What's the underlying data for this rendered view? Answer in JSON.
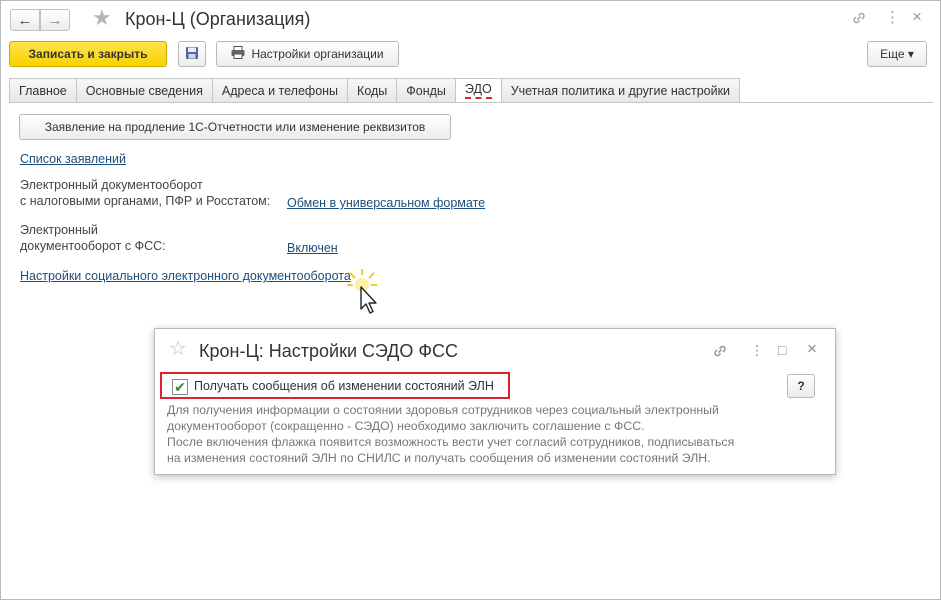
{
  "window": {
    "title": "Крон-Ц (Организация)",
    "nav_back": "←",
    "nav_forward": "→",
    "link_icon": "link-icon",
    "more_icon": "⋮",
    "close_icon": "×"
  },
  "toolbar": {
    "save_close_label": "Записать и закрыть",
    "save_icon": "floppy-disk-icon",
    "org_settings_label": "Настройки организации",
    "more_label": "Еще ▾"
  },
  "tabs": [
    {
      "label": "Главное"
    },
    {
      "label": "Основные сведения"
    },
    {
      "label": "Адреса и телефоны"
    },
    {
      "label": "Коды"
    },
    {
      "label": "Фонды"
    },
    {
      "label": "ЭДО",
      "active": true
    },
    {
      "label": "Учетная политика и другие настройки"
    }
  ],
  "edo": {
    "statement_button": "Заявление на продление 1С-Отчетности или изменение реквизитов",
    "statements_list_link": "Список заявлений",
    "edo_tax_label_1": "Электронный документооборот",
    "edo_tax_label_2": "с налоговыми органами, ПФР и Росстатом:",
    "exchange_link": "Обмен в универсальном формате",
    "edo_fss_label_1": "Электронный",
    "edo_fss_label_2": "документооборот с ФСС:",
    "fss_status_link": "Включен",
    "social_edo_settings_link": "Настройки социального электронного документооборота"
  },
  "dialog": {
    "title": "Крон-Ц: Настройки СЭДО ФСС",
    "checkbox_label": "Получать сообщения об изменении состояний ЭЛН",
    "checkbox_checked": true,
    "help_label": "?",
    "maximize_icon": "□",
    "close_icon": "×",
    "more_icon": "⋮",
    "description": [
      "Для получения информации о состоянии здоровья сотрудников через социальный электронный",
      "документооборот (сокращенно - СЭДО) необходимо заключить соглашение с ФСС.",
      "После включения флажка появится возможность вести учет согласий сотрудников, подписываться",
      "на изменения состояний ЭЛН по СНИЛС и получать сообщения об изменении состояний ЭЛН."
    ]
  },
  "colors": {
    "primary_button": "#f7d200",
    "link": "#1c4e7c",
    "highlight_frame": "#d9252b",
    "active_tab_underline": "#d22"
  }
}
